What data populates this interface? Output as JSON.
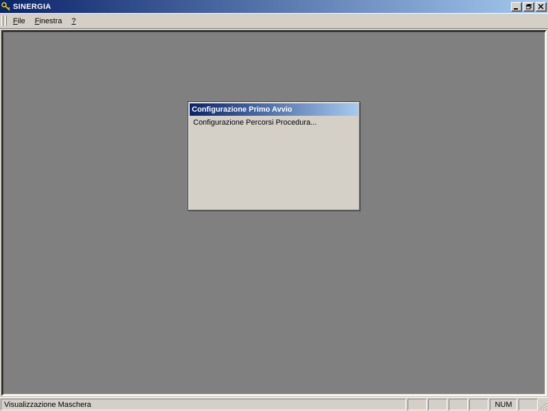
{
  "titlebar": {
    "title": "SINERGIA"
  },
  "menubar": {
    "file": "File",
    "file_mnemonic": "F",
    "finestra": "Finestra",
    "finestra_mnemonic": "F",
    "help": "?"
  },
  "child_window": {
    "title": "Configurazione Primo Avvio",
    "item1": "Configurazione Percorsi Procedura..."
  },
  "statusbar": {
    "main": "Visualizzazione Maschera",
    "num": "NUM"
  }
}
